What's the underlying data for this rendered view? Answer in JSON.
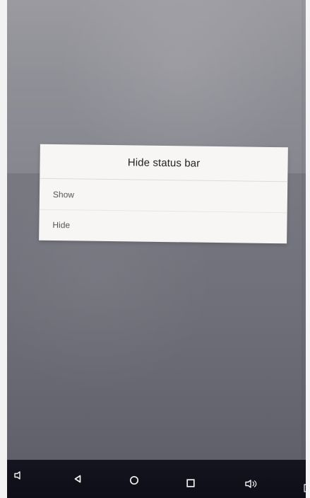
{
  "dialog": {
    "title": "Hide status bar",
    "options": [
      {
        "label": "Show"
      },
      {
        "label": "Hide"
      }
    ]
  },
  "navigation": {
    "icons": [
      "speaker-icon",
      "back-icon",
      "home-icon",
      "recent-apps-icon",
      "volume-icon",
      "screenshot-icon"
    ]
  },
  "colors": {
    "screen_background": "#8a8a92",
    "dialog_background": "#f7f6f4",
    "navigation_background": "#11111b",
    "navigation_icon": "#f2f2f2",
    "title_text": "#222222",
    "option_text": "#555555"
  }
}
